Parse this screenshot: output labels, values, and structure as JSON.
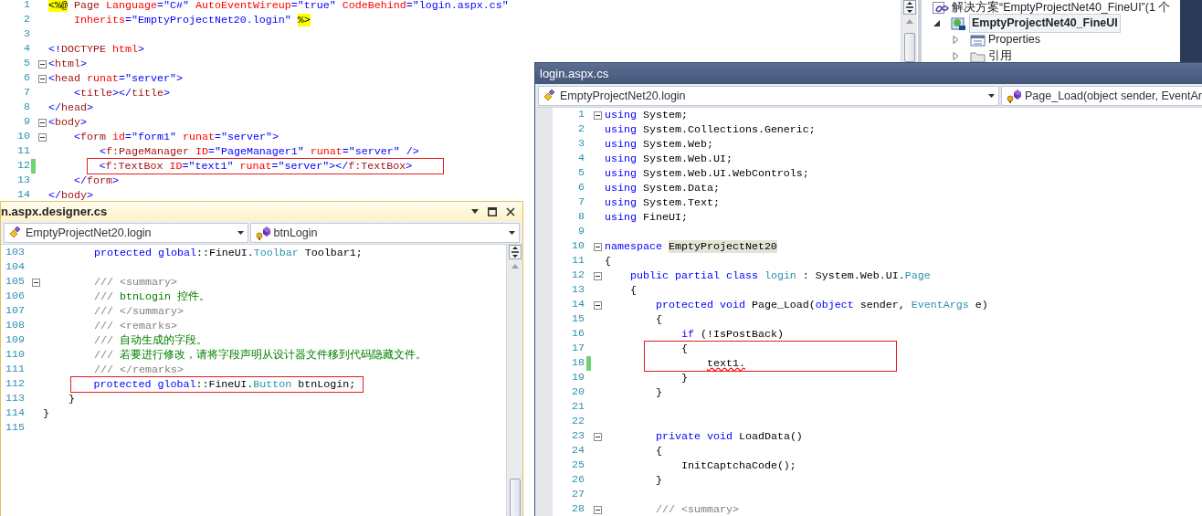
{
  "markup_editor": {
    "lines": [
      {
        "number": "1",
        "fold": false,
        "changed": false,
        "tokens": [
          {
            "kind": "directive",
            "text": "<%@"
          },
          {
            "kind": "tag",
            "text": " Page"
          },
          {
            "kind": "attr",
            "text": " Language"
          },
          {
            "kind": "punct",
            "text": "="
          },
          {
            "kind": "value",
            "text": "\"C#\""
          },
          {
            "kind": "attr",
            "text": " AutoEventWireup"
          },
          {
            "kind": "punct",
            "text": "="
          },
          {
            "kind": "value",
            "text": "\"true\""
          },
          {
            "kind": "attr",
            "text": " CodeBehind"
          },
          {
            "kind": "punct",
            "text": "="
          },
          {
            "kind": "value",
            "text": "\"login.aspx.cs\""
          }
        ]
      },
      {
        "number": "2",
        "fold": false,
        "changed": false,
        "tokens": [
          {
            "kind": "attr",
            "text": "    Inherits"
          },
          {
            "kind": "punct",
            "text": "="
          },
          {
            "kind": "value",
            "text": "\"EmptyProjectNet20.login\" "
          },
          {
            "kind": "directive",
            "text": "%>"
          }
        ]
      },
      {
        "number": "3",
        "fold": false,
        "changed": false
      },
      {
        "number": "4",
        "fold": false,
        "changed": false,
        "tokens": [
          {
            "kind": "punct",
            "text": "<!"
          },
          {
            "kind": "tag",
            "text": "DOCTYPE"
          },
          {
            "kind": "attr",
            "text": " html"
          },
          {
            "kind": "punct",
            "text": ">"
          }
        ]
      },
      {
        "number": "5",
        "fold": true,
        "changed": false,
        "tokens": [
          {
            "kind": "punct",
            "text": "<"
          },
          {
            "kind": "tag",
            "text": "html"
          },
          {
            "kind": "punct",
            "text": ">"
          }
        ]
      },
      {
        "number": "6",
        "fold": true,
        "changed": false,
        "tokens": [
          {
            "kind": "punct",
            "text": "<"
          },
          {
            "kind": "tag",
            "text": "head"
          },
          {
            "kind": "attr",
            "text": " runat"
          },
          {
            "kind": "punct",
            "text": "="
          },
          {
            "kind": "value",
            "text": "\"server\""
          },
          {
            "kind": "punct",
            "text": ">"
          }
        ]
      },
      {
        "number": "7",
        "fold": false,
        "changed": false,
        "tokens": [
          {
            "kind": "punct",
            "text": "    <"
          },
          {
            "kind": "tag",
            "text": "title"
          },
          {
            "kind": "punct",
            "text": "></"
          },
          {
            "kind": "tag",
            "text": "title"
          },
          {
            "kind": "punct",
            "text": ">"
          }
        ]
      },
      {
        "number": "8",
        "fold": false,
        "changed": false,
        "tokens": [
          {
            "kind": "punct",
            "text": "</"
          },
          {
            "kind": "tag",
            "text": "head"
          },
          {
            "kind": "punct",
            "text": ">"
          }
        ]
      },
      {
        "number": "9",
        "fold": true,
        "changed": false,
        "tokens": [
          {
            "kind": "punct",
            "text": "<"
          },
          {
            "kind": "tag",
            "text": "body"
          },
          {
            "kind": "punct",
            "text": ">"
          }
        ]
      },
      {
        "number": "10",
        "fold": true,
        "changed": false,
        "tokens": [
          {
            "kind": "punct",
            "text": "    <"
          },
          {
            "kind": "tag",
            "text": "form"
          },
          {
            "kind": "attr",
            "text": " id"
          },
          {
            "kind": "punct",
            "text": "="
          },
          {
            "kind": "value",
            "text": "\"form1\""
          },
          {
            "kind": "attr",
            "text": " runat"
          },
          {
            "kind": "punct",
            "text": "="
          },
          {
            "kind": "value",
            "text": "\"server\""
          },
          {
            "kind": "punct",
            "text": ">"
          }
        ]
      },
      {
        "number": "11",
        "fold": false,
        "changed": false,
        "tokens": [
          {
            "kind": "punct",
            "text": "        <"
          },
          {
            "kind": "tag",
            "text": "f:PageManager"
          },
          {
            "kind": "attr",
            "text": " ID"
          },
          {
            "kind": "punct",
            "text": "="
          },
          {
            "kind": "value",
            "text": "\"PageManager1\""
          },
          {
            "kind": "attr",
            "text": " runat"
          },
          {
            "kind": "punct",
            "text": "="
          },
          {
            "kind": "value",
            "text": "\"server\""
          },
          {
            "kind": "punct",
            "text": " />"
          }
        ]
      },
      {
        "number": "12",
        "fold": false,
        "changed": true,
        "tokens": [
          {
            "kind": "punct",
            "text": "        <"
          },
          {
            "kind": "tag",
            "text": "f:TextBox"
          },
          {
            "kind": "attr",
            "text": " ID"
          },
          {
            "kind": "punct",
            "text": "="
          },
          {
            "kind": "value",
            "text": "\"text1\""
          },
          {
            "kind": "attr",
            "text": " runat"
          },
          {
            "kind": "punct",
            "text": "="
          },
          {
            "kind": "value",
            "text": "\"server\""
          },
          {
            "kind": "punct",
            "text": "></"
          },
          {
            "kind": "tag",
            "text": "f:TextBox"
          },
          {
            "kind": "punct",
            "text": ">"
          }
        ]
      },
      {
        "number": "13",
        "fold": false,
        "changed": false,
        "tokens": [
          {
            "kind": "punct",
            "text": "    </"
          },
          {
            "kind": "tag",
            "text": "form"
          },
          {
            "kind": "punct",
            "text": ">"
          }
        ]
      },
      {
        "number": "14",
        "fold": false,
        "changed": false,
        "tokens": [
          {
            "kind": "punct",
            "text": "</"
          },
          {
            "kind": "tag",
            "text": "body"
          },
          {
            "kind": "punct",
            "text": ">"
          }
        ]
      }
    ]
  },
  "solution_explorer": {
    "solution": {
      "label": "解决方案“EmptyProjectNet40_FineUI”(1 个"
    },
    "items": [
      {
        "kind": "project",
        "label": "EmptyProjectNet40_FineUI",
        "selected": true,
        "expanded": true,
        "children": [
          {
            "kind": "properties",
            "label": "Properties",
            "selected": false,
            "expanded": false
          },
          {
            "kind": "references",
            "label": "引用",
            "selected": false,
            "expanded": false
          }
        ]
      }
    ]
  },
  "designer_window": {
    "title": "n.aspx.designer.cs",
    "type_selector": "EmptyProjectNet20.login",
    "member_selector": "btnLogin",
    "lines": [
      {
        "number": "103",
        "fold": false,
        "changed": false,
        "tokens": [
          {
            "kind": "keyword",
            "text": "        protected global"
          },
          {
            "kind": "plain",
            "text": "::FineUI."
          },
          {
            "kind": "type",
            "text": "Toolbar"
          },
          {
            "kind": "plain",
            "text": " Toolbar1;"
          }
        ]
      },
      {
        "number": "104",
        "fold": false,
        "changed": false
      },
      {
        "number": "105",
        "fold": true,
        "changed": false,
        "tokens": [
          {
            "kind": "doc",
            "text": "        /// <summary>"
          }
        ]
      },
      {
        "number": "106",
        "fold": false,
        "changed": false,
        "tokens": [
          {
            "kind": "doc",
            "text": "        ///"
          },
          {
            "kind": "comment",
            "text": " btnLogin 控件。"
          }
        ]
      },
      {
        "number": "107",
        "fold": false,
        "changed": false,
        "tokens": [
          {
            "kind": "doc",
            "text": "        /// </summary>"
          }
        ]
      },
      {
        "number": "108",
        "fold": false,
        "changed": false,
        "tokens": [
          {
            "kind": "doc",
            "text": "        /// <remarks>"
          }
        ]
      },
      {
        "number": "109",
        "fold": false,
        "changed": false,
        "tokens": [
          {
            "kind": "doc",
            "text": "        ///"
          },
          {
            "kind": "comment",
            "text": " 自动生成的字段。"
          }
        ]
      },
      {
        "number": "110",
        "fold": false,
        "changed": false,
        "tokens": [
          {
            "kind": "doc",
            "text": "        ///"
          },
          {
            "kind": "comment",
            "text": " 若要进行修改，请将字段声明从设计器文件移到代码隐藏文件。"
          }
        ]
      },
      {
        "number": "111",
        "fold": false,
        "changed": false,
        "tokens": [
          {
            "kind": "doc",
            "text": "        /// </remarks>"
          }
        ]
      },
      {
        "number": "112",
        "fold": false,
        "changed": false,
        "tokens": [
          {
            "kind": "keyword",
            "text": "        protected global"
          },
          {
            "kind": "plain",
            "text": "::FineUI."
          },
          {
            "kind": "type",
            "text": "Button"
          },
          {
            "kind": "plain",
            "text": " btnLogin;"
          }
        ]
      },
      {
        "number": "113",
        "fold": false,
        "changed": false,
        "tokens": [
          {
            "kind": "plain",
            "text": "    }"
          }
        ]
      },
      {
        "number": "114",
        "fold": false,
        "changed": false,
        "tokens": [
          {
            "kind": "plain",
            "text": "}"
          }
        ]
      },
      {
        "number": "115",
        "fold": false,
        "changed": false
      }
    ]
  },
  "code_window": {
    "title": "login.aspx.cs",
    "type_selector": "EmptyProjectNet20.login",
    "member_selector": "Page_Load(object sender, EventAr",
    "lines": [
      {
        "number": "1",
        "fold": true,
        "changed": false,
        "tokens": [
          {
            "kind": "keyword",
            "text": "using"
          },
          {
            "kind": "plain",
            "text": " System;"
          }
        ]
      },
      {
        "number": "2",
        "fold": false,
        "changed": false,
        "tokens": [
          {
            "kind": "keyword",
            "text": "using"
          },
          {
            "kind": "plain",
            "text": " System.Collections.Generic;"
          }
        ]
      },
      {
        "number": "3",
        "fold": false,
        "changed": false,
        "tokens": [
          {
            "kind": "keyword",
            "text": "using"
          },
          {
            "kind": "plain",
            "text": " System.Web;"
          }
        ]
      },
      {
        "number": "4",
        "fold": false,
        "changed": false,
        "tokens": [
          {
            "kind": "keyword",
            "text": "using"
          },
          {
            "kind": "plain",
            "text": " System.Web.UI;"
          }
        ]
      },
      {
        "number": "5",
        "fold": false,
        "changed": false,
        "tokens": [
          {
            "kind": "keyword",
            "text": "using"
          },
          {
            "kind": "plain",
            "text": " System.Web.UI.WebControls;"
          }
        ]
      },
      {
        "number": "6",
        "fold": false,
        "changed": false,
        "tokens": [
          {
            "kind": "keyword",
            "text": "using"
          },
          {
            "kind": "plain",
            "text": " System.Data;"
          }
        ]
      },
      {
        "number": "7",
        "fold": false,
        "changed": false,
        "tokens": [
          {
            "kind": "keyword",
            "text": "using"
          },
          {
            "kind": "plain",
            "text": " System.Text;"
          }
        ]
      },
      {
        "number": "8",
        "fold": false,
        "changed": false,
        "tokens": [
          {
            "kind": "keyword",
            "text": "using"
          },
          {
            "kind": "plain",
            "text": " FineUI;"
          }
        ]
      },
      {
        "number": "9",
        "fold": false,
        "changed": false
      },
      {
        "number": "10",
        "fold": true,
        "changed": false,
        "tokens": [
          {
            "kind": "keyword",
            "text": "namespace "
          },
          {
            "kind": "ident",
            "text": "EmptyProjectNet20"
          }
        ]
      },
      {
        "number": "11",
        "fold": false,
        "changed": false,
        "tokens": [
          {
            "kind": "plain",
            "text": "{"
          }
        ]
      },
      {
        "number": "12",
        "fold": true,
        "changed": false,
        "tokens": [
          {
            "kind": "keyword",
            "text": "    public partial class "
          },
          {
            "kind": "type",
            "text": "login"
          },
          {
            "kind": "plain",
            "text": " : System.Web.UI."
          },
          {
            "kind": "type",
            "text": "Page"
          }
        ]
      },
      {
        "number": "13",
        "fold": false,
        "changed": false,
        "tokens": [
          {
            "kind": "plain",
            "text": "    {"
          }
        ]
      },
      {
        "number": "14",
        "fold": true,
        "changed": false,
        "tokens": [
          {
            "kind": "keyword",
            "text": "        protected void"
          },
          {
            "kind": "plain",
            "text": " Page_Load("
          },
          {
            "kind": "keyword",
            "text": "object"
          },
          {
            "kind": "plain",
            "text": " sender, "
          },
          {
            "kind": "type",
            "text": "EventArgs"
          },
          {
            "kind": "plain",
            "text": " e)"
          }
        ]
      },
      {
        "number": "15",
        "fold": false,
        "changed": false,
        "tokens": [
          {
            "kind": "plain",
            "text": "        {"
          }
        ]
      },
      {
        "number": "16",
        "fold": false,
        "changed": false,
        "tokens": [
          {
            "kind": "keyword",
            "text": "            if"
          },
          {
            "kind": "plain",
            "text": " (!IsPostBack)"
          }
        ]
      },
      {
        "number": "17",
        "fold": false,
        "changed": false,
        "tokens": [
          {
            "kind": "plain",
            "text": "            {"
          }
        ]
      },
      {
        "number": "18",
        "fold": false,
        "changed": true,
        "tokens": [
          {
            "kind": "error",
            "text": "                text1."
          }
        ]
      },
      {
        "number": "19",
        "fold": false,
        "changed": false,
        "tokens": [
          {
            "kind": "plain",
            "text": "            }"
          }
        ]
      },
      {
        "number": "20",
        "fold": false,
        "changed": false,
        "tokens": [
          {
            "kind": "plain",
            "text": "        }"
          }
        ]
      },
      {
        "number": "21",
        "fold": false,
        "changed": false
      },
      {
        "number": "22",
        "fold": false,
        "changed": false
      },
      {
        "number": "23",
        "fold": true,
        "changed": false,
        "tokens": [
          {
            "kind": "keyword",
            "text": "        private void"
          },
          {
            "kind": "plain",
            "text": " LoadData()"
          }
        ]
      },
      {
        "number": "24",
        "fold": false,
        "changed": false,
        "tokens": [
          {
            "kind": "plain",
            "text": "        {"
          }
        ]
      },
      {
        "number": "25",
        "fold": false,
        "changed": false,
        "tokens": [
          {
            "kind": "plain",
            "text": "            InitCaptchaCode();"
          }
        ]
      },
      {
        "number": "26",
        "fold": false,
        "changed": false,
        "tokens": [
          {
            "kind": "plain",
            "text": "        }"
          }
        ]
      },
      {
        "number": "27",
        "fold": false,
        "changed": false
      },
      {
        "number": "28",
        "fold": true,
        "changed": false,
        "tokens": [
          {
            "kind": "doc",
            "text": "        /// <summary>"
          }
        ]
      }
    ]
  }
}
